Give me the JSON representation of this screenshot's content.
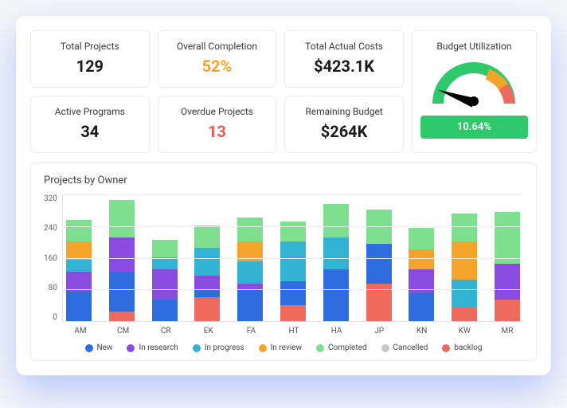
{
  "kpis": {
    "total_projects": {
      "label": "Total Projects",
      "value": "129"
    },
    "overall_completion": {
      "label": "Overall Completion",
      "value": "52%"
    },
    "total_actual_costs": {
      "label": "Total Actual Costs",
      "value": "$423.1K"
    },
    "active_programs": {
      "label": "Active Programs",
      "value": "34"
    },
    "overdue_projects": {
      "label": "Overdue Projects",
      "value": "13"
    },
    "remaining_budget": {
      "label": "Remaining Budget",
      "value": "$264K"
    },
    "budget_util": {
      "label": "Budget Utilization",
      "percent": "10.64%"
    }
  },
  "chart_data": {
    "type": "bar",
    "title": "Projects by Owner",
    "ylabel": "",
    "xlabel": "",
    "ylim": [
      0,
      320
    ],
    "y_ticks": [
      "320",
      "240",
      "160",
      "80",
      "0"
    ],
    "categories": [
      "AM",
      "CM",
      "CR",
      "EK",
      "FA",
      "HT",
      "HA",
      "JP",
      "KN",
      "KW",
      "MR"
    ],
    "series": [
      {
        "name": "backlog",
        "color": "#ee6a5c",
        "values": [
          0,
          25,
          0,
          60,
          0,
          40,
          0,
          95,
          0,
          35,
          55
        ]
      },
      {
        "name": "New",
        "color": "#2d6de0",
        "values": [
          75,
          100,
          55,
          20,
          80,
          60,
          130,
          100,
          70,
          0,
          0
        ]
      },
      {
        "name": "In research",
        "color": "#8a4be0",
        "values": [
          50,
          85,
          75,
          35,
          15,
          0,
          0,
          0,
          60,
          0,
          90
        ]
      },
      {
        "name": "In progress",
        "color": "#32b3d4",
        "values": [
          30,
          0,
          30,
          70,
          55,
          100,
          80,
          0,
          0,
          70,
          0
        ]
      },
      {
        "name": "In review",
        "color": "#f2a52a",
        "values": [
          45,
          0,
          0,
          0,
          50,
          0,
          0,
          0,
          50,
          95,
          0
        ]
      },
      {
        "name": "Completed",
        "color": "#7ee08f",
        "values": [
          55,
          95,
          45,
          55,
          60,
          50,
          85,
          85,
          55,
          70,
          130
        ]
      },
      {
        "name": "Cancelled",
        "color": "#c7c7c7",
        "values": [
          0,
          0,
          0,
          0,
          0,
          0,
          0,
          0,
          0,
          0,
          0
        ]
      }
    ],
    "legend_order": [
      "New",
      "In research",
      "In progress",
      "In review",
      "Completed",
      "Cancelled",
      "backlog"
    ]
  }
}
